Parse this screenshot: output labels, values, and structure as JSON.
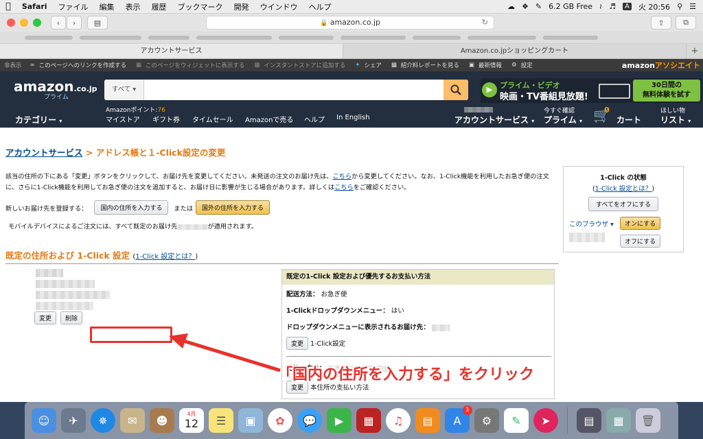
{
  "menubar": {
    "apple": "",
    "app": "Safari",
    "menus": [
      "ファイル",
      "編集",
      "表示",
      "履歴",
      "ブックマーク",
      "開発",
      "ウインドウ",
      "ヘルプ"
    ],
    "storage": "6.2 GB Free",
    "input_badge": "A",
    "clock": "火 20:56"
  },
  "browser": {
    "url": "amazon.co.jp",
    "tabs": [
      "アカウントサービス",
      "Amazon.co.jpショッピングカート"
    ],
    "new_tab": "+"
  },
  "associate_bar": {
    "label_hide": "非表示",
    "items": [
      "このページへのリンクを作成する",
      "このページをウィジェットに表示する",
      "インスタントストアに追加する",
      "シェア",
      "紹介料レポートを見る",
      "最新情報",
      "設定"
    ],
    "brand": "amazon",
    "brand_suffix": "アソシエイト"
  },
  "header": {
    "logo": "amazon",
    "logo_suffix": ".co.jp",
    "logo_sub": "プライム",
    "search_category": "すべて",
    "prime_title": "プライム・ビデオ",
    "prime_text": "映画・TV番組見放題!",
    "prime_trial_1": "30日間の",
    "prime_trial_2": "無料体験を試す",
    "points_label": "Amazonポイント:",
    "points_value": "76",
    "category": "カテゴリー",
    "nav_links": [
      "マイストア",
      "ギフト券",
      "タイムセール",
      "Amazonで売る",
      "ヘルプ",
      "In English"
    ],
    "account": "アカウントサービス",
    "prime_small": "今すぐ確認",
    "prime": "プライム",
    "cart_count": "0",
    "cart": "カート",
    "wishlist_small": "ほしい物",
    "wishlist": "リスト"
  },
  "content": {
    "breadcrumb_link": "アカウントサービス",
    "breadcrumb_sep": ">",
    "breadcrumb_current": "アドレス帳と１-Click設定の変更",
    "desc_1": "該当の住所の下にある「変更」ボタンをクリックして、お届け先を変更してください。未発送の注文のお届け先は、",
    "desc_link1": "こちら",
    "desc_2": "から変更してください。なお、1-Click機能を利用したお急ぎ便の注文に、さらに1-Click機能を利用してお急ぎ便の注文を追加すると、お届け日に影響が生じる場合があります。詳しくは",
    "desc_link2": "こちら",
    "desc_3": "をご確認ください。",
    "register_label": "新しいお届け先を登録する：",
    "btn_domestic": "国内の住所を入力する",
    "or": "または",
    "btn_foreign": "国外の住所を入力する",
    "mobile_note_a": "モバイルデバイスによるご注文には、すべて既定のお届け先",
    "mobile_note_b": "が適用されます。",
    "section_title": "既定の住所および 1-Click 設定",
    "section_link": "1-Click 設定とは？",
    "btn_edit": "変更",
    "btn_delete": "削除",
    "pay_head": "既定の1-Click 設定および優先するお支払い方法",
    "ship_label": "配送方法：",
    "ship_value": "お急ぎ便",
    "dropdown_label": "1-Clickドロップダウンメニュー：",
    "dropdown_value": "はい",
    "dropdown_addr_label": "ドロップダウンメニューに表示されるお届け先：",
    "oneclick_setting": "1-Click設定",
    "payment_label": "支払い方法：",
    "billing": "本住所の支払い方法"
  },
  "sidebar": {
    "title": "1-Click の状態",
    "link": "1-Click 設定とは？",
    "btn_all_off": "すべてをオフにする",
    "browser_label": "このブラウザ",
    "btn_on": "オンにする",
    "btn_off": "オフにする"
  },
  "annotation": {
    "callout": "「国内の住所を入力する」をクリック",
    "color": "#e8312b"
  },
  "dock": {
    "badge": "1",
    "calendar_month": "4月",
    "calendar_day": "12"
  }
}
